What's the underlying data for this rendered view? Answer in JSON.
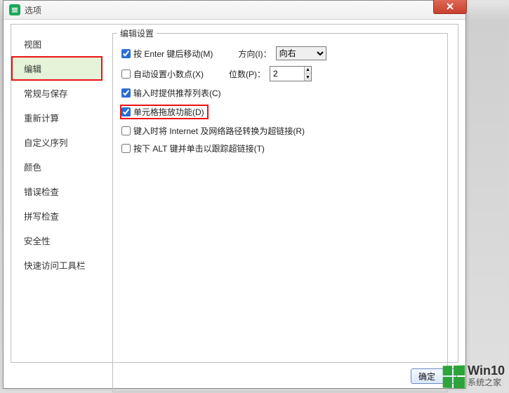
{
  "window": {
    "title": "选项"
  },
  "sidebar": {
    "items": [
      {
        "label": "视图"
      },
      {
        "label": "编辑"
      },
      {
        "label": "常规与保存"
      },
      {
        "label": "重新计算"
      },
      {
        "label": "自定义序列"
      },
      {
        "label": "颜色"
      },
      {
        "label": "错误检查"
      },
      {
        "label": "拼写检查"
      },
      {
        "label": "安全性"
      },
      {
        "label": "快速访问工具栏"
      }
    ],
    "selected_index": 1
  },
  "settings": {
    "group_title": "编辑设置",
    "enter_move": {
      "label": "按 Enter 键后移动(M)",
      "checked": true
    },
    "direction": {
      "label": "方向(I)：",
      "value": "向右"
    },
    "auto_decimal": {
      "label": "自动设置小数点(X)",
      "checked": false
    },
    "places": {
      "label": "位数(P)：",
      "value": "2"
    },
    "suggest_list": {
      "label": "输入时提供推荐列表(C)",
      "checked": true
    },
    "cell_drag": {
      "label": "单元格拖放功能(D)",
      "checked": true
    },
    "hyperlink_convert": {
      "label": "键入时将 Internet 及网络路径转换为超链接(R)",
      "checked": false
    },
    "alt_click_link": {
      "label": "按下 ALT 键并单击以跟踪超链接(T)",
      "checked": false
    }
  },
  "footer": {
    "ok": "确定"
  },
  "brand": {
    "line1": "Win10",
    "line2": "系统之家"
  }
}
